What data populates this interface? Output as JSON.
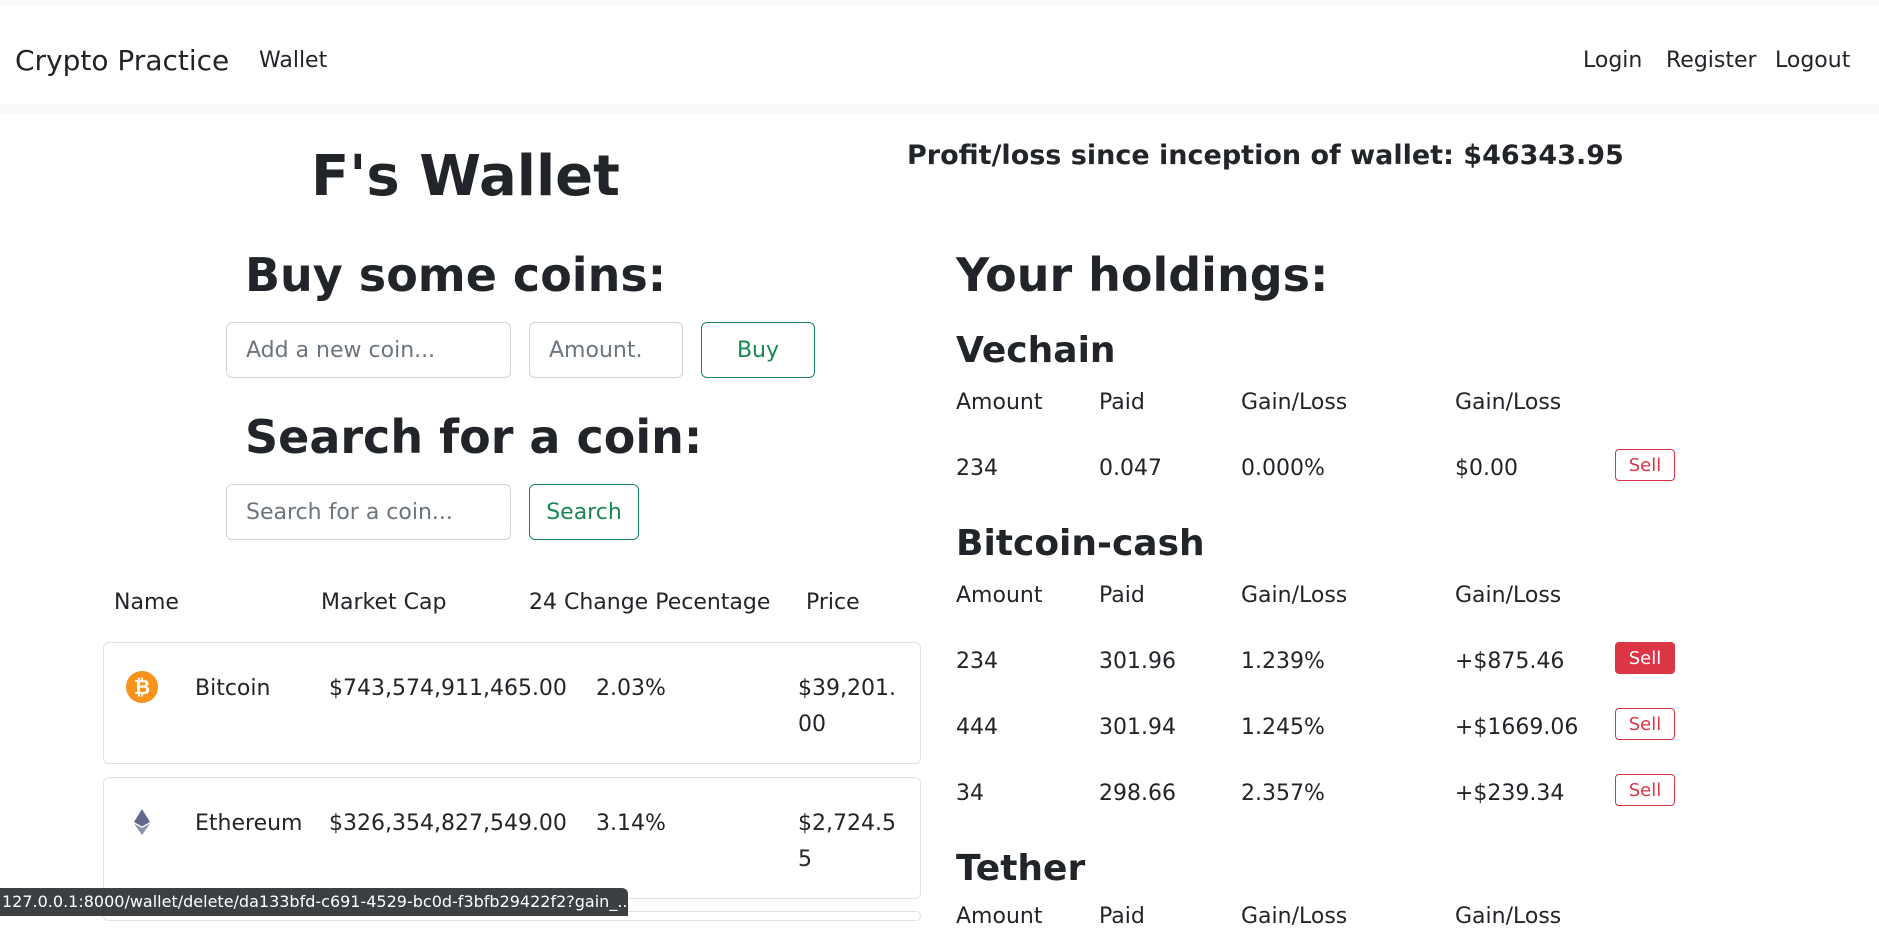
{
  "nav": {
    "brand": "Crypto Practice",
    "wallet": "Wallet",
    "login": "Login",
    "register": "Register",
    "logout": "Logout"
  },
  "wallet_title": "F's Wallet",
  "profit_text": "Profit/loss since inception of wallet: $46343.95",
  "buy": {
    "title": "Buy some coins:",
    "coin_placeholder": "Add a new coin...",
    "amount_placeholder": "Amount.",
    "button": "Buy"
  },
  "search": {
    "title": "Search for a coin:",
    "placeholder": "Search for a coin...",
    "button": "Search"
  },
  "market": {
    "headers": [
      "Name",
      "Market Cap",
      "24 Change Pecentage",
      "Price"
    ],
    "rows": [
      {
        "name": "Bitcoin",
        "market_cap": "$743,574,911,465.00",
        "change": "2.03%",
        "price": "$39,201.00",
        "icon": "bitcoin-icon"
      },
      {
        "name": "Ethereum",
        "market_cap": "$326,354,827,549.00",
        "change": "3.14%",
        "price": "$2,724.55",
        "icon": "ethereum-icon"
      }
    ]
  },
  "holdings": {
    "title": "Your holdings:",
    "col_headers": [
      "Amount",
      "Paid",
      "Gain/Loss",
      "Gain/Loss"
    ],
    "sell_label": "Sell",
    "coins": [
      {
        "name": "Vechain",
        "rows": [
          {
            "amount": "234",
            "paid": "0.047",
            "pct": "0.000%",
            "usd": "$0.00"
          }
        ]
      },
      {
        "name": "Bitcoin-cash",
        "rows": [
          {
            "amount": "234",
            "paid": "301.96",
            "pct": "1.239%",
            "usd": "+$875.46"
          },
          {
            "amount": "444",
            "paid": "301.94",
            "pct": "1.245%",
            "usd": "+$1669.06"
          },
          {
            "amount": "34",
            "paid": "298.66",
            "pct": "2.357%",
            "usd": "+$239.34"
          }
        ]
      },
      {
        "name": "Tether",
        "rows": []
      }
    ]
  },
  "status_url": "127.0.0.1:8000/wallet/delete/da133bfd-c691-4529-bc0d-f3bfb29422f2?gain_..."
}
